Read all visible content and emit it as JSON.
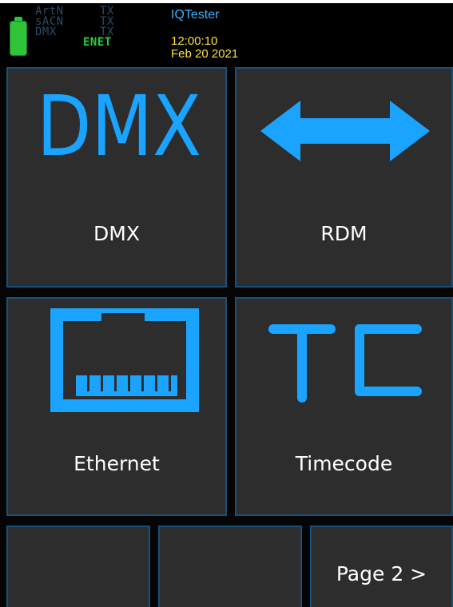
{
  "status": {
    "protocols": [
      {
        "name": "ArtN",
        "state": "TX"
      },
      {
        "name": "sACN",
        "state": "TX"
      },
      {
        "name": "DMX",
        "state": "TX"
      }
    ],
    "network": "ENET",
    "battery_icon": "battery-icon",
    "app_title": "IQTester",
    "time": "12:00:10",
    "date": "Feb 20 2021",
    "colors": {
      "protocol_dim": "#2b4a66",
      "network": "#27d03b",
      "title": "#3ab3ff",
      "clock": "#ffe23a",
      "battery": "#2fc43a"
    }
  },
  "tiles": [
    {
      "label": "DMX",
      "icon_text": "DMX",
      "icon": "dmx-icon"
    },
    {
      "label": "RDM",
      "icon": "double-arrow-icon"
    },
    {
      "label": "Ethernet",
      "icon": "ethernet-port-icon"
    },
    {
      "label": "Timecode",
      "icon_text": "TC",
      "icon": "timecode-icon"
    }
  ],
  "page_button": {
    "label": "Page 2 >"
  },
  "colors": {
    "accent": "#1aa3ff",
    "tile_bg": "#2d2d2d",
    "tile_border": "#17507a",
    "background": "#050505"
  }
}
